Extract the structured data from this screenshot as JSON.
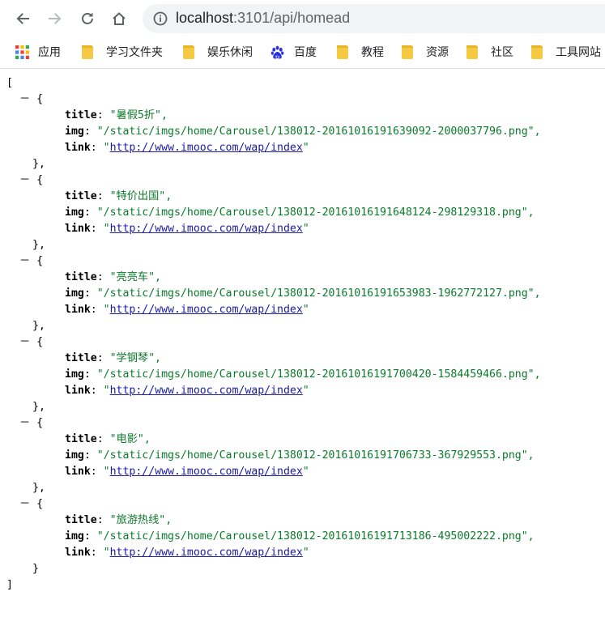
{
  "browser": {
    "url_host": "localhost",
    "url_rest": ":3101/api/homead"
  },
  "bookmarks": [
    {
      "label": "应用",
      "icon": "apps-grid-icon"
    },
    {
      "label": "学习文件夹",
      "icon": "folder-icon"
    },
    {
      "label": "娱乐休闲",
      "icon": "folder-icon"
    },
    {
      "label": "百度",
      "icon": "baidu-paw-icon"
    },
    {
      "label": "教程",
      "icon": "folder-icon"
    },
    {
      "label": "资源",
      "icon": "folder-icon"
    },
    {
      "label": "社区",
      "icon": "folder-icon"
    },
    {
      "label": "工具网站",
      "icon": "folder-icon"
    }
  ],
  "json_view": {
    "open_bracket": "[",
    "close_bracket": "]",
    "toggle": "－ {",
    "close_obj": "},",
    "close_last": "}",
    "key_title": "title",
    "key_img": "img",
    "key_link": "link",
    "items": [
      {
        "title": "\"暑假5折\",",
        "img": "\"/static/imgs/home/Carousel/138012-20161016191639092-2000037796.png\",",
        "link": "http://www.imooc.com/wap/index"
      },
      {
        "title": "\"特价出国\",",
        "img": "\"/static/imgs/home/Carousel/138012-20161016191648124-298129318.png\",",
        "link": "http://www.imooc.com/wap/index"
      },
      {
        "title": "\"亮亮车\",",
        "img": "\"/static/imgs/home/Carousel/138012-20161016191653983-1962772127.png\",",
        "link": "http://www.imooc.com/wap/index"
      },
      {
        "title": "\"学钢琴\",",
        "img": "\"/static/imgs/home/Carousel/138012-20161016191700420-1584459466.png\",",
        "link": "http://www.imooc.com/wap/index"
      },
      {
        "title": "\"电影\",",
        "img": "\"/static/imgs/home/Carousel/138012-20161016191706733-367929553.png\",",
        "link": "http://www.imooc.com/wap/index"
      },
      {
        "title": "\"旅游热线\",",
        "img": "\"/static/imgs/home/Carousel/138012-20161016191713186-495002222.png\",",
        "link": "http://www.imooc.com/wap/index"
      }
    ]
  }
}
